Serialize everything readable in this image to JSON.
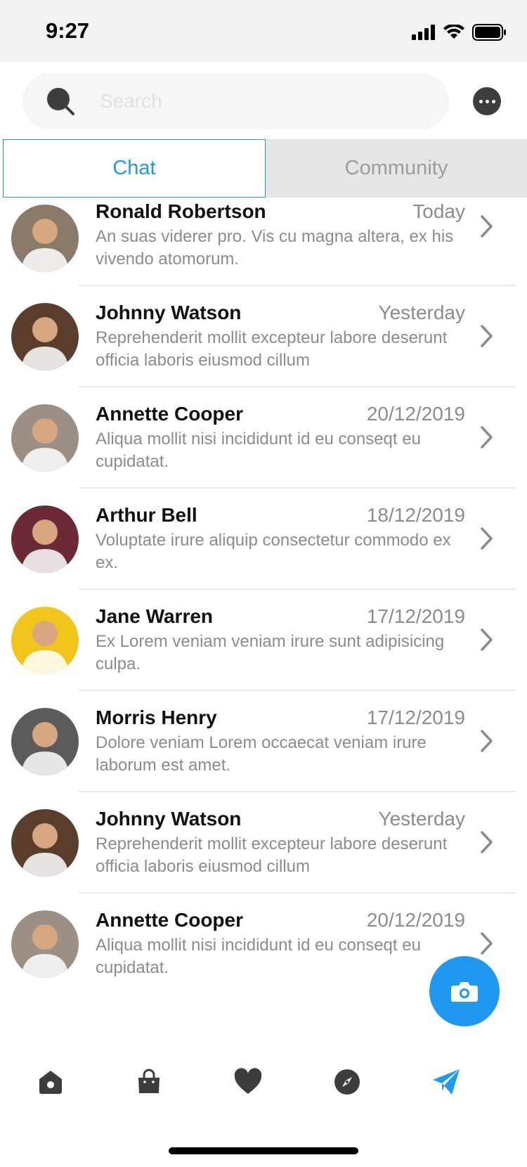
{
  "status_bar": {
    "time": "9:27"
  },
  "search": {
    "placeholder": "Search",
    "value": ""
  },
  "tabs": [
    {
      "label": "Chat",
      "active": true
    },
    {
      "label": "Community",
      "active": false
    }
  ],
  "chats": [
    {
      "name": "Ronald Robertson",
      "date": "Today",
      "preview": "An suas viderer pro. Vis cu magna altera, ex his vivendo atomorum.",
      "avatar_color": "#8a7a6a"
    },
    {
      "name": "Johnny Watson",
      "date": "Yesterday",
      "preview": "Reprehenderit mollit excepteur labore deserunt officia laboris eiusmod cillum",
      "avatar_color": "#5a3e2b"
    },
    {
      "name": "Annette Cooper",
      "date": "20/12/2019",
      "preview": "Aliqua mollit nisi incididunt id eu conseqt eu cupidatat.",
      "avatar_color": "#9b8f86"
    },
    {
      "name": "Arthur Bell",
      "date": "18/12/2019",
      "preview": "Voluptate irure aliquip consectetur commodo ex ex.",
      "avatar_color": "#6b2a35"
    },
    {
      "name": "Jane Warren",
      "date": "17/12/2019",
      "preview": "Ex Lorem veniam veniam irure sunt adipisicing culpa.",
      "avatar_color": "#f2c51d"
    },
    {
      "name": "Morris Henry",
      "date": "17/12/2019",
      "preview": "Dolore veniam Lorem occaecat veniam irure laborum est amet.",
      "avatar_color": "#5b5b5b"
    },
    {
      "name": "Johnny Watson",
      "date": "Yesterday",
      "preview": "Reprehenderit mollit excepteur labore deserunt officia laboris eiusmod cillum",
      "avatar_color": "#5a3e2b"
    },
    {
      "name": "Annette Cooper",
      "date": "20/12/2019",
      "preview": "Aliqua mollit nisi incididunt id eu conseqt eu cupidatat.",
      "avatar_color": "#9b8f86"
    }
  ],
  "bottom_nav": [
    {
      "icon": "home-icon",
      "active": false
    },
    {
      "icon": "shopping-bag-icon",
      "active": false
    },
    {
      "icon": "heart-icon",
      "active": false
    },
    {
      "icon": "compass-icon",
      "active": false
    },
    {
      "icon": "send-icon",
      "active": true
    }
  ],
  "colors": {
    "accent": "#2196f3",
    "fab": "#1e98f0",
    "icon_dark": "#3d3d3d",
    "text_muted": "#8c8c8c"
  }
}
